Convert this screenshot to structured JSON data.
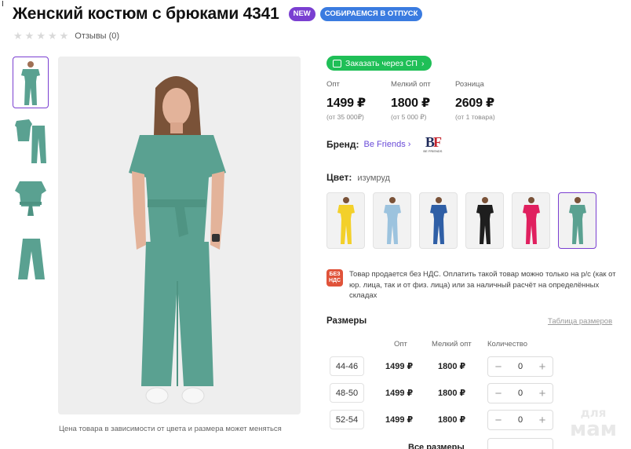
{
  "cursor_mark": "I",
  "product": {
    "title": "Женский костюм с брюками 4341",
    "badges": [
      "NEW",
      "СОБИРАЕМСЯ В ОТПУСК"
    ],
    "rating_stars": 0,
    "reviews_label": "Отзывы (0)",
    "price_note": "Цена товара в зависимости от цвета и размера может меняться"
  },
  "sp_button": {
    "label": "Заказать через СП",
    "icon": "cart-icon"
  },
  "prices": [
    {
      "label": "Опт",
      "value": "1499 ₽",
      "min": "(от 35 000₽)"
    },
    {
      "label": "Мелкий опт",
      "value": "1800 ₽",
      "min": "(от 5 000 ₽)"
    },
    {
      "label": "Розница",
      "value": "2609 ₽",
      "min": "(от 1 товара)"
    }
  ],
  "brand": {
    "label": "Бренд:",
    "name": "Be Friends",
    "logo_text": "BF",
    "logo_sub": "BE FRIENDS"
  },
  "color": {
    "label": "Цвет:",
    "value": "изумруд",
    "swatches": [
      {
        "name": "yellow",
        "hex": "#f3d02a"
      },
      {
        "name": "light-blue",
        "hex": "#9cc3de"
      },
      {
        "name": "blue",
        "hex": "#2f5fa6"
      },
      {
        "name": "black",
        "hex": "#1e1e1e"
      },
      {
        "name": "fuchsia",
        "hex": "#e0205f"
      },
      {
        "name": "emerald",
        "hex": "#5aa191"
      }
    ]
  },
  "vat": {
    "icon_text": "БЕЗ НДС",
    "text": "Товар продается без НДС. Оплатить такой товар можно только на р/с (как от юр. лица, так и от физ. лица) или за наличный расчёт на определённых складах"
  },
  "sizes": {
    "title": "Размеры",
    "table_link": "Таблица размеров",
    "headers": {
      "opt": "Опт",
      "small_opt": "Мелкий опт",
      "quantity": "Количество"
    },
    "rows": [
      {
        "size": "44-46",
        "opt": "1499 ₽",
        "small_opt": "1800 ₽",
        "qty": "0"
      },
      {
        "size": "48-50",
        "opt": "1499 ₽",
        "small_opt": "1800 ₽",
        "qty": "0"
      },
      {
        "size": "52-54",
        "opt": "1499 ₽",
        "small_opt": "1800 ₽",
        "qty": "0"
      }
    ],
    "all_sizes_label": "Все размеры",
    "minus": "−",
    "plus": "+"
  },
  "watermark": {
    "line1": "для",
    "line2": "мам"
  },
  "colors": {
    "accent": "#7a3fd1",
    "green": "#1fbf57",
    "suit": "#5aa191",
    "vat": "#e0533a"
  }
}
